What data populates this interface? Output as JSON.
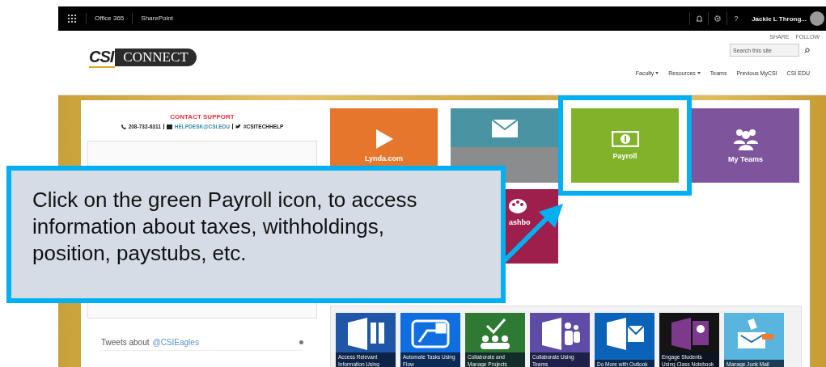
{
  "topbar": {
    "items": [
      "Office 365",
      "SharePoint"
    ],
    "help": "?",
    "user": "Jackie L Throng..."
  },
  "header": {
    "logo": {
      "part_1": "CSI",
      "part_2": "CONNECT"
    },
    "actions": [
      "SHARE",
      "FOLLOW"
    ],
    "search": {
      "placeholder": "Search this site"
    },
    "nav": [
      {
        "label": "Faculty",
        "dropdown": true
      },
      {
        "label": "Resources",
        "dropdown": true
      },
      {
        "label": "Teams",
        "dropdown": false
      },
      {
        "label": "Previous MyCSI",
        "dropdown": false
      },
      {
        "label": "CSI EDU",
        "dropdown": false
      }
    ]
  },
  "contact": {
    "title": "CONTACT SUPPORT",
    "phone": "208-732-6311",
    "email": "HELPDESK@CSI.EDU",
    "hashtag": "#CSITECHHELP"
  },
  "tiles": [
    {
      "kind": "play",
      "label": "Lynda.com",
      "color": "#e5762b",
      "highlighted": false
    },
    {
      "kind": "mail",
      "color": "#4a93a3",
      "highlighted": false
    },
    {
      "kind": "money",
      "label": "Payroll",
      "color": "#80b22a",
      "highlighted": true
    },
    {
      "kind": "people",
      "label": "My Teams",
      "color": "#7e559c",
      "highlighted": false
    },
    {
      "kind": "palette",
      "label": "ashbo",
      "color": "#9e1f4b",
      "highlighted": false
    }
  ],
  "apps": [
    {
      "kind": "delve",
      "label": "Access Relevant Information Using",
      "color": "#1f56a5"
    },
    {
      "kind": "flow",
      "label": "Automate Tasks Using Flow",
      "color": "#0f6fe0"
    },
    {
      "kind": "planner",
      "label": "Collaborate and Manage Projects",
      "color": "#2f7a33"
    },
    {
      "kind": "teams",
      "label": "Collaborate Using Teams",
      "color": "#5d4ba6"
    },
    {
      "kind": "outlook",
      "label": "Do More with Outlook",
      "color": "#0a63b8"
    },
    {
      "kind": "onenote",
      "label": "Engage Students Using Class Notebook",
      "color": "#141414"
    },
    {
      "kind": "junk",
      "label": "Manage Junk Mail",
      "color": "#5ab5de"
    }
  ],
  "tweets": {
    "prefix": "Tweets about",
    "handle": "@CSIEagles"
  },
  "callout": {
    "text": "Click on the green Payroll icon, to access information about taxes, withholdings, position, paystubs, etc."
  }
}
